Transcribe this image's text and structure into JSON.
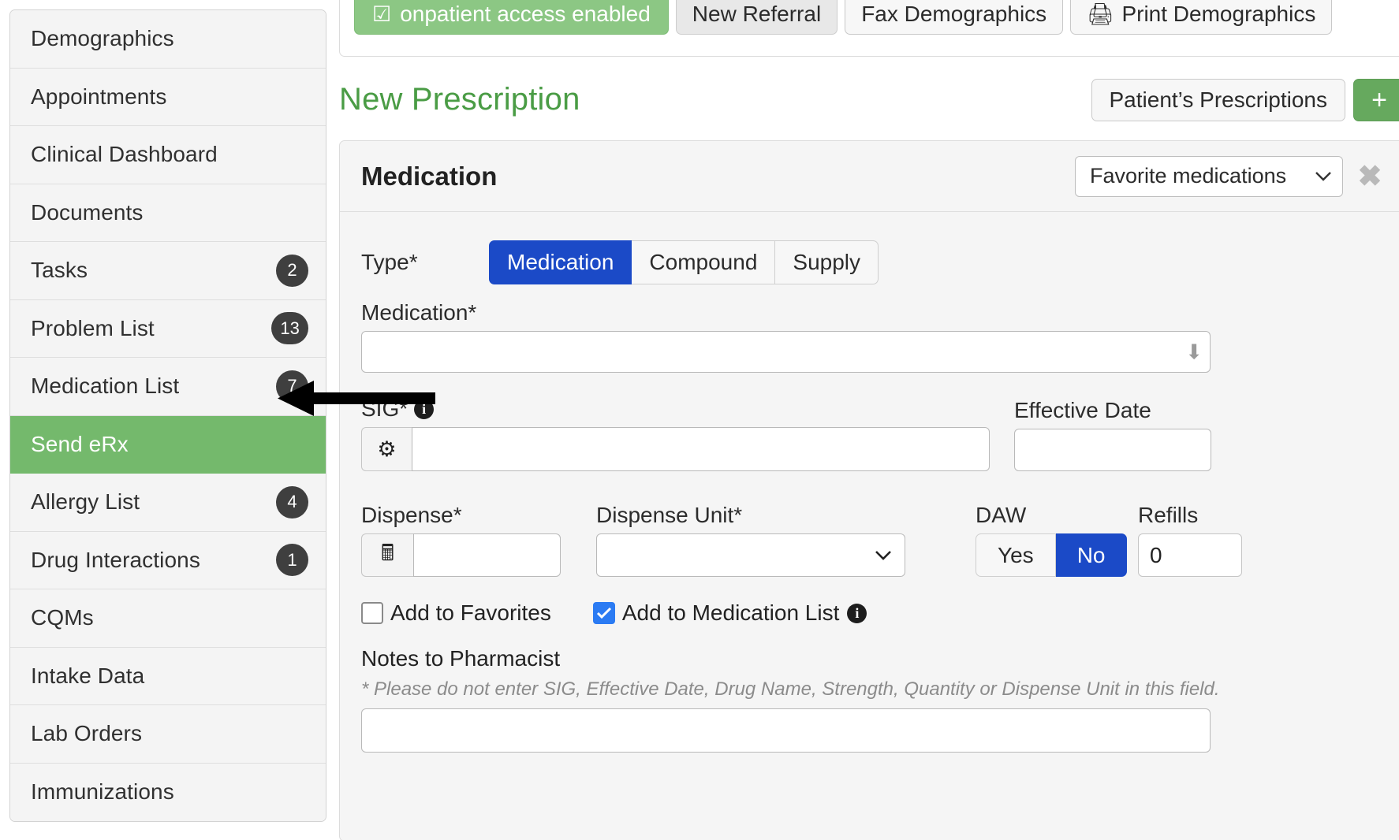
{
  "sidebar": {
    "items": [
      {
        "label": "Demographics",
        "badge": "",
        "active": false
      },
      {
        "label": "Appointments",
        "badge": "",
        "active": false
      },
      {
        "label": "Clinical Dashboard",
        "badge": "",
        "active": false
      },
      {
        "label": "Documents",
        "badge": "",
        "active": false
      },
      {
        "label": "Tasks",
        "badge": "2",
        "active": false
      },
      {
        "label": "Problem List",
        "badge": "13",
        "active": false
      },
      {
        "label": "Medication List",
        "badge": "7",
        "active": false
      },
      {
        "label": "Send eRx",
        "badge": "",
        "active": true
      },
      {
        "label": "Allergy List",
        "badge": "4",
        "active": false
      },
      {
        "label": "Drug Interactions",
        "badge": "1",
        "active": false
      },
      {
        "label": "CQMs",
        "badge": "",
        "active": false
      },
      {
        "label": "Intake Data",
        "badge": "",
        "active": false
      },
      {
        "label": "Lab Orders",
        "badge": "",
        "active": false
      },
      {
        "label": "Immunizations",
        "badge": "",
        "active": false
      }
    ],
    "active_color": "#74b96c",
    "badge_color": "#3f3f3f"
  },
  "toolbar": {
    "onpatient_label": "onpatient access enabled",
    "onpatient_icon": "checkbox-checked-icon",
    "new_referral_label": "New Referral",
    "fax_demographics_label": "Fax Demographics",
    "print_demographics_label": "Print Demographics",
    "print_icon": "printer-icon"
  },
  "section": {
    "title": "New Prescription",
    "title_color": "#4a9c45",
    "patients_prescriptions_label": "Patient’s Prescriptions",
    "add_button_label": "+",
    "add_button_color": "#66a95e"
  },
  "panel": {
    "title": "Medication",
    "favorites_select_value": "Favorite medications",
    "favorites_caret": "chevron-down-icon",
    "close_label": "✖"
  },
  "form": {
    "type_label": "Type*",
    "type_options": [
      "Medication",
      "Compound",
      "Supply"
    ],
    "type_selected": "Medication",
    "type_selected_color": "#1b4ac7",
    "medication_label": "Medication*",
    "medication_value": "",
    "medication_placeholder": "",
    "sig_label": "SIG*",
    "sig_value": "",
    "sig_gear_icon": "gear-icon",
    "sig_info_icon": "info-icon",
    "effective_date_label": "Effective Date",
    "effective_date_value": "",
    "dispense_label": "Dispense*",
    "dispense_value": "",
    "dispense_calc_icon": "calculator-icon",
    "dispense_unit_label": "Dispense Unit*",
    "dispense_unit_value": "",
    "daw_label": "DAW",
    "daw_options": [
      "Yes",
      "No"
    ],
    "daw_selected": "No",
    "refills_label": "Refills",
    "refills_value": "0",
    "add_to_favorites_label": "Add to Favorites",
    "add_to_favorites_checked": false,
    "add_to_medication_list_label": "Add to Medication List",
    "add_to_medication_list_checked": true,
    "medication_list_info_icon": "info-icon",
    "notes_title": "Notes to Pharmacist",
    "notes_warning": "* Please do not enter SIG, Effective Date, Drug Name, Strength, Quantity or Dispense Unit in this field.",
    "notes_value": ""
  },
  "annotation": {
    "arrow_name": "pointer-arrow",
    "arrow_target": "Send eRx"
  }
}
